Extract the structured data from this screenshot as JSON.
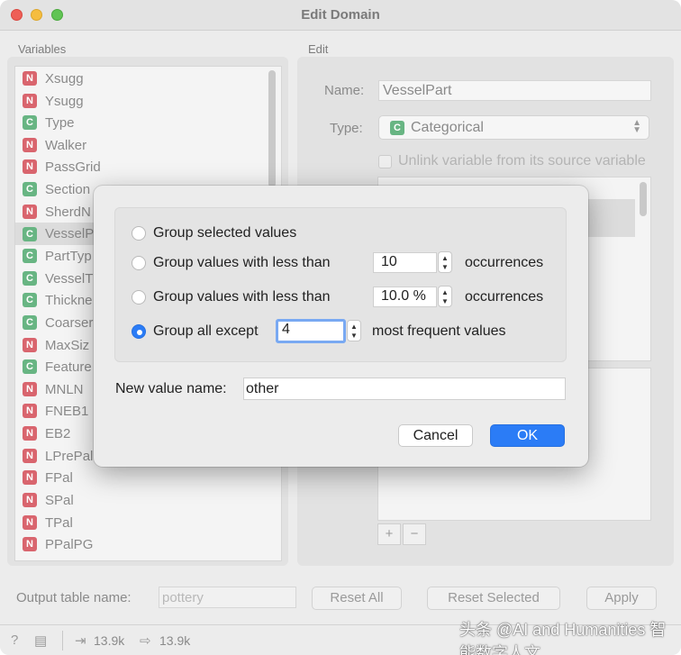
{
  "window": {
    "title": "Edit Domain"
  },
  "variables": {
    "label": "Variables",
    "items": [
      {
        "type": "N",
        "name": "Xsugg"
      },
      {
        "type": "N",
        "name": "Ysugg"
      },
      {
        "type": "C",
        "name": "Type"
      },
      {
        "type": "N",
        "name": "Walker"
      },
      {
        "type": "N",
        "name": "PassGrid"
      },
      {
        "type": "C",
        "name": "Section"
      },
      {
        "type": "N",
        "name": "SherdN"
      },
      {
        "type": "C",
        "name": "VesselP"
      },
      {
        "type": "C",
        "name": "PartTyp"
      },
      {
        "type": "C",
        "name": "VesselT"
      },
      {
        "type": "C",
        "name": "Thickne"
      },
      {
        "type": "C",
        "name": "Coarser"
      },
      {
        "type": "N",
        "name": "MaxSiz"
      },
      {
        "type": "C",
        "name": "Feature"
      },
      {
        "type": "N",
        "name": "MNLN"
      },
      {
        "type": "N",
        "name": "FNEB1"
      },
      {
        "type": "N",
        "name": "EB2"
      },
      {
        "type": "N",
        "name": "LPrePal"
      },
      {
        "type": "N",
        "name": "FPal"
      },
      {
        "type": "N",
        "name": "SPal"
      },
      {
        "type": "N",
        "name": "TPal"
      },
      {
        "type": "N",
        "name": "PPalPG"
      }
    ],
    "selected_index": 7
  },
  "edit": {
    "label": "Edit",
    "name_label": "Name:",
    "name_value": "VesselPart",
    "type_label": "Type:",
    "type_badge": "C",
    "type_value": "Categorical",
    "unlink_label": "Unlink variable from its source variable",
    "add_label": "+",
    "remove_label": "−"
  },
  "dialog": {
    "options": [
      {
        "label": "Group selected values",
        "selected": false
      },
      {
        "label": "Group values with less than",
        "value": "10",
        "suffix": "occurrences",
        "selected": false
      },
      {
        "label": "Group values with less than",
        "value": "10.0 %",
        "suffix": "occurrences",
        "selected": false
      },
      {
        "label": "Group all except",
        "value": "4",
        "suffix": "most frequent values",
        "selected": true
      }
    ],
    "new_value_label": "New value name:",
    "new_value": "other",
    "cancel_label": "Cancel",
    "ok_label": "OK"
  },
  "bottom": {
    "output_label": "Output table name:",
    "output_placeholder": "pottery",
    "reset_all": "Reset All",
    "reset_selected": "Reset Selected",
    "apply": "Apply"
  },
  "status": {
    "input_size": "13.9k",
    "output_size": "13.9k"
  },
  "watermark": "头条 @AI and Humanities 智能数字人文",
  "colors": {
    "numeric_badge": "#d9656e",
    "categorical_badge": "#68b583",
    "accent": "#2b7cf6"
  }
}
